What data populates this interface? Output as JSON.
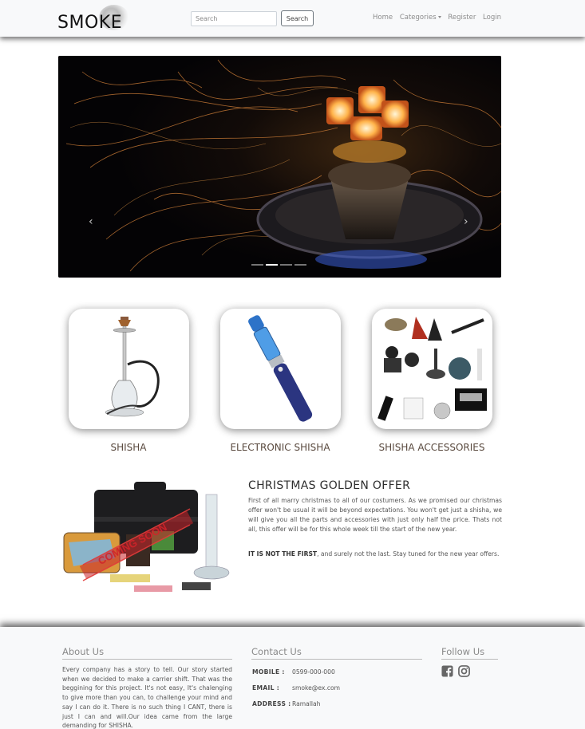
{
  "navbar": {
    "brand": "SMOKE",
    "search_placeholder": "Search",
    "search_button": "Search",
    "links": {
      "home": "Home",
      "categories": "Categories",
      "register": "Register",
      "login": "Login"
    }
  },
  "carousel": {
    "prev_icon": "chevron-left-icon",
    "next_icon": "chevron-right-icon",
    "slide_count": 4,
    "active_slide": 2
  },
  "categories": [
    {
      "label": "SHISHA"
    },
    {
      "label": "ELECTRONIC SHISHA"
    },
    {
      "label": "SHISHA ACCESSORIES"
    }
  ],
  "offer": {
    "title": "CHRISTMAS GOLDEN OFFER",
    "stamp": "COMING SOON",
    "body": "First of all marry christmas to all of our costumers. As we promised our christmas offer won't be usual it will be beyond expectations. You won't get just a shisha, we will give you all the parts and accessories with just only half the price. Thats not all, this offer will be for this whole week till the start of the new year.",
    "note_bold": "IT IS NOT THE FIRST",
    "note_rest": ", and surely not the last. Stay tuned for the new year offers."
  },
  "footer": {
    "about": {
      "heading": "About Us",
      "text": "Every company has a story to tell. Our story started when we decided to make a carrier shift. That was the beggining for this project. It's not easy, It's chalenging to give more than you can, to challenge your mind and say I can do it. There is no such thing I CANT, there is just I can and will.Our idea came from the large demanding for SHISHA."
    },
    "contact": {
      "heading": "Contact Us",
      "mobile_label": "MOBILE :",
      "mobile": "0599-000-000",
      "email_label": "EMAIL :",
      "email": "smoke@ex.com",
      "address_label": "ADDRESS :",
      "address": "Ramallah"
    },
    "follow": {
      "heading": "Follow Us",
      "icons": [
        "facebook-icon",
        "instagram-icon"
      ]
    }
  }
}
